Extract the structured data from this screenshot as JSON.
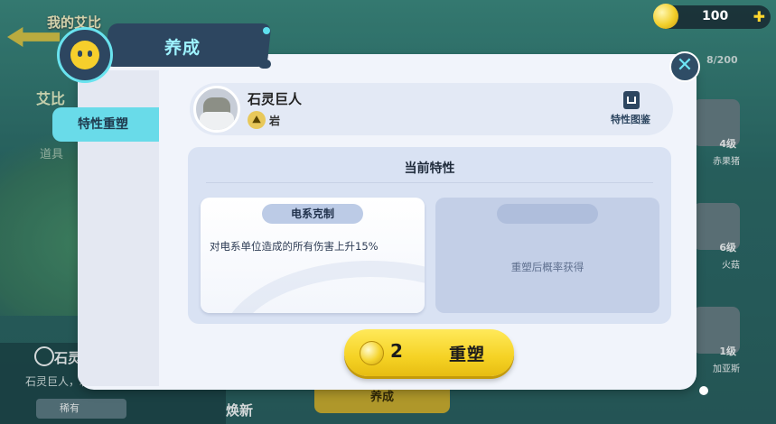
{
  "background": {
    "title": "我的艾比",
    "name": "艾比",
    "sub_tab": "道具",
    "pet_name": "石灵",
    "pet_desc": "石灵巨人，岩",
    "rarity": "稀有",
    "train_button": "养成",
    "swap_button": "焕新",
    "collection_count": "8/200",
    "cards": [
      {
        "level": "4级",
        "name": "赤果猪"
      },
      {
        "level": "6级",
        "name": "火菇"
      },
      {
        "level": "1级",
        "name": "加亚斯"
      }
    ]
  },
  "currency": {
    "value": "100",
    "icon": "coin-icon",
    "add_icon": "plus-icon"
  },
  "header": {
    "title": "养成",
    "logo_icon": "pet-face-icon"
  },
  "sidebar": {
    "active_tab": "特性重塑"
  },
  "character": {
    "name": "石灵巨人",
    "element": "岩",
    "element_icon": "rock-element-icon",
    "codex_label": "特性图鉴",
    "codex_icon": "book-icon"
  },
  "traits": {
    "section_title": "当前特性",
    "current": {
      "name": "电系克制",
      "description": "对电系单位造成的所有伤害上升15%"
    },
    "new_hint": "重塑后概率获得"
  },
  "action": {
    "cost": "2",
    "label": "重塑",
    "cost_icon": "coin-icon"
  },
  "colors": {
    "accent": "#69dbe9",
    "banner": "#2d4660",
    "button": "#f5d224"
  }
}
